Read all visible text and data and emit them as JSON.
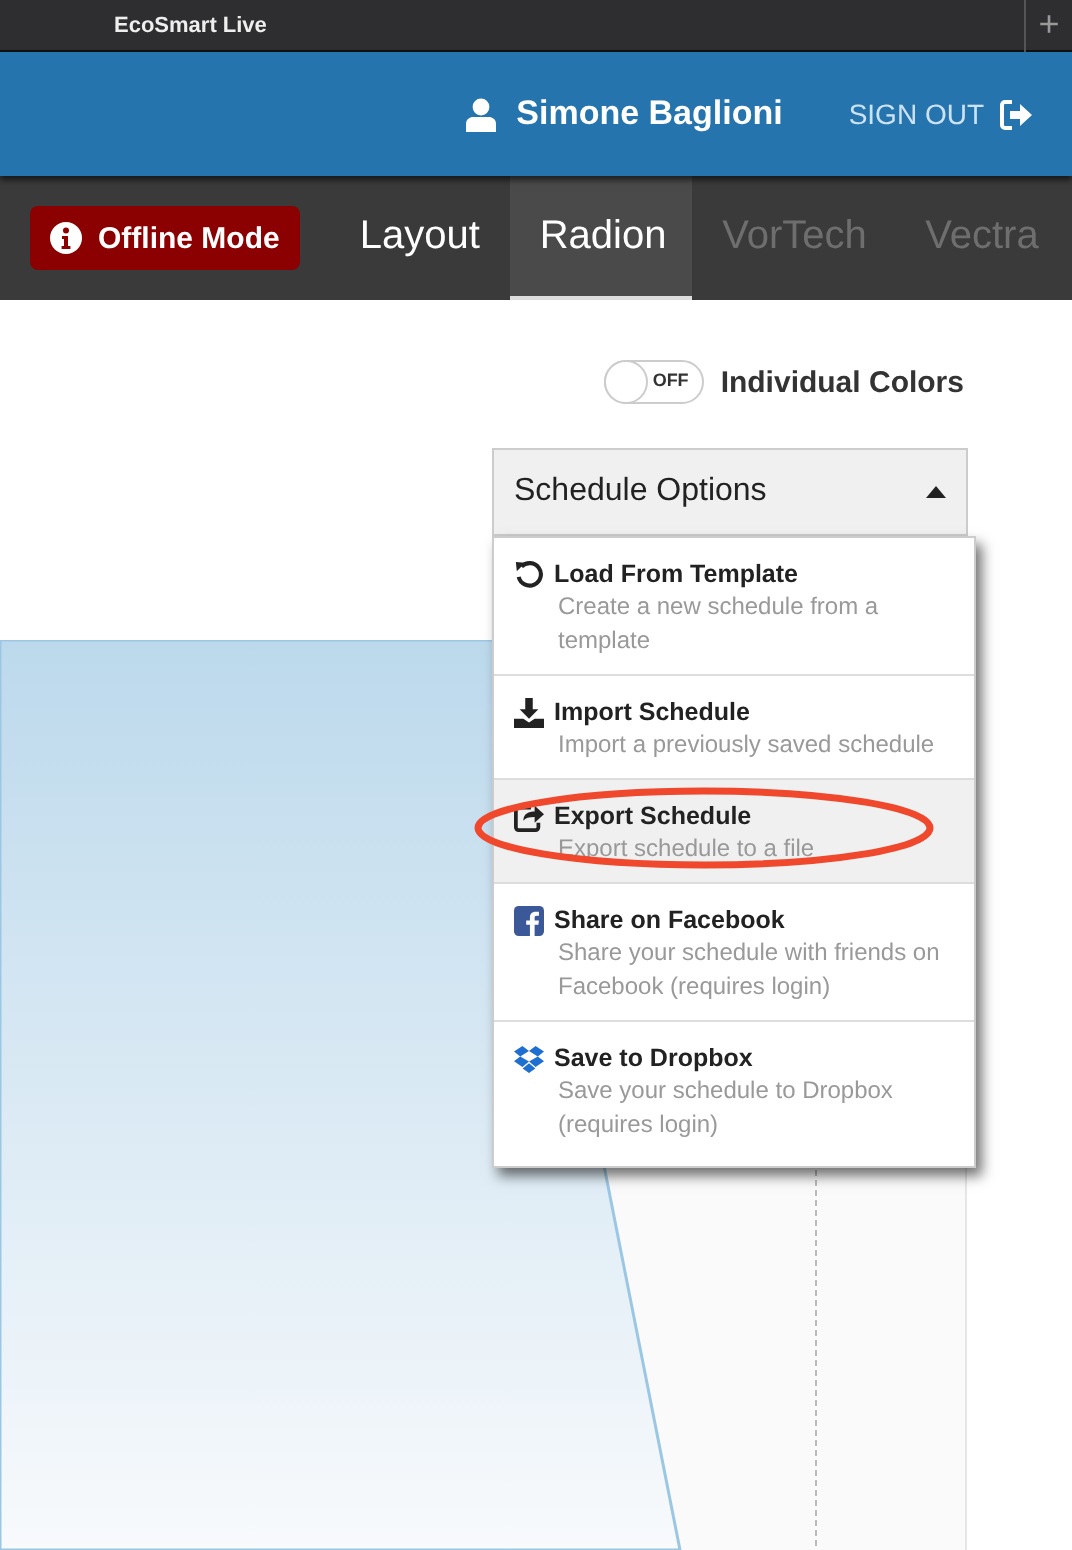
{
  "window": {
    "title": "EcoSmart Live",
    "new_tab": "+"
  },
  "header": {
    "user": "Simone Baglioni",
    "sign_out": "SIGN OUT"
  },
  "offline_badge": "Offline Mode",
  "tabs": [
    {
      "label": "Layout",
      "selected": false,
      "disabled": false
    },
    {
      "label": "Radion",
      "selected": true,
      "disabled": false
    },
    {
      "label": "VorTech",
      "selected": false,
      "disabled": true
    },
    {
      "label": "Vectra",
      "selected": false,
      "disabled": true
    }
  ],
  "individual_colors": {
    "toggle_text": "OFF",
    "on": false,
    "label": "Individual Colors"
  },
  "schedule_options": {
    "label": "Schedule Options",
    "expanded": true,
    "items": [
      {
        "kind": "reload",
        "title": "Load From Template",
        "description": "Create a new schedule from a template",
        "selected": false,
        "circled": false
      },
      {
        "kind": "download",
        "title": "Import Schedule",
        "description": "Import a previously saved schedule",
        "selected": false,
        "circled": false
      },
      {
        "kind": "share",
        "title": "Export Schedule",
        "description": "Export schedule to a file",
        "selected": true,
        "circled": true
      },
      {
        "kind": "facebook",
        "title": "Share on Facebook",
        "description": "Share your schedule with friends on Facebook (requires login)",
        "selected": false,
        "circled": false
      },
      {
        "kind": "dropbox",
        "title": "Save to Dropbox",
        "description": "Save your schedule to Dropbox (requires login)",
        "selected": false,
        "circled": false
      }
    ]
  }
}
